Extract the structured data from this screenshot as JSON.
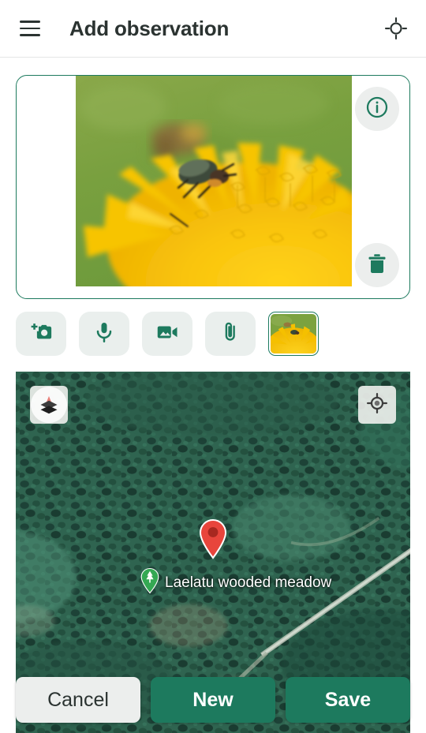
{
  "header": {
    "title": "Add observation",
    "menu_icon": "hamburger-menu-icon",
    "gps_icon": "gps-crosshair-icon"
  },
  "media_card": {
    "photo_alt": "beetle on yellow dandelion flower",
    "info_icon": "info-circle-icon",
    "info_label": "i",
    "delete_icon": "trash-icon"
  },
  "toolbar": {
    "items": [
      {
        "name": "add-photo-button",
        "icon": "camera-plus-icon"
      },
      {
        "name": "record-audio-button",
        "icon": "microphone-icon"
      },
      {
        "name": "add-video-button",
        "icon": "video-camera-icon"
      },
      {
        "name": "attach-file-button",
        "icon": "paperclip-icon"
      }
    ],
    "thumbnail": {
      "name": "photo-thumbnail",
      "selected": true,
      "alt": "beetle on yellow dandelion flower"
    }
  },
  "map": {
    "layers_icon": "map-layers-icon",
    "locate_icon": "my-location-icon",
    "marker_icon": "map-pin-icon",
    "place_icon": "park-tree-pin-icon",
    "place_label": "Laelatu wooded meadow"
  },
  "footer": {
    "cancel_label": "Cancel",
    "new_label": "New",
    "save_label": "Save"
  },
  "colors": {
    "brand_green": "#1d7a5e",
    "button_grey": "#eceeed",
    "text_dark": "#2b3331",
    "marker_red": "#e8453c",
    "place_green": "#34a853"
  }
}
